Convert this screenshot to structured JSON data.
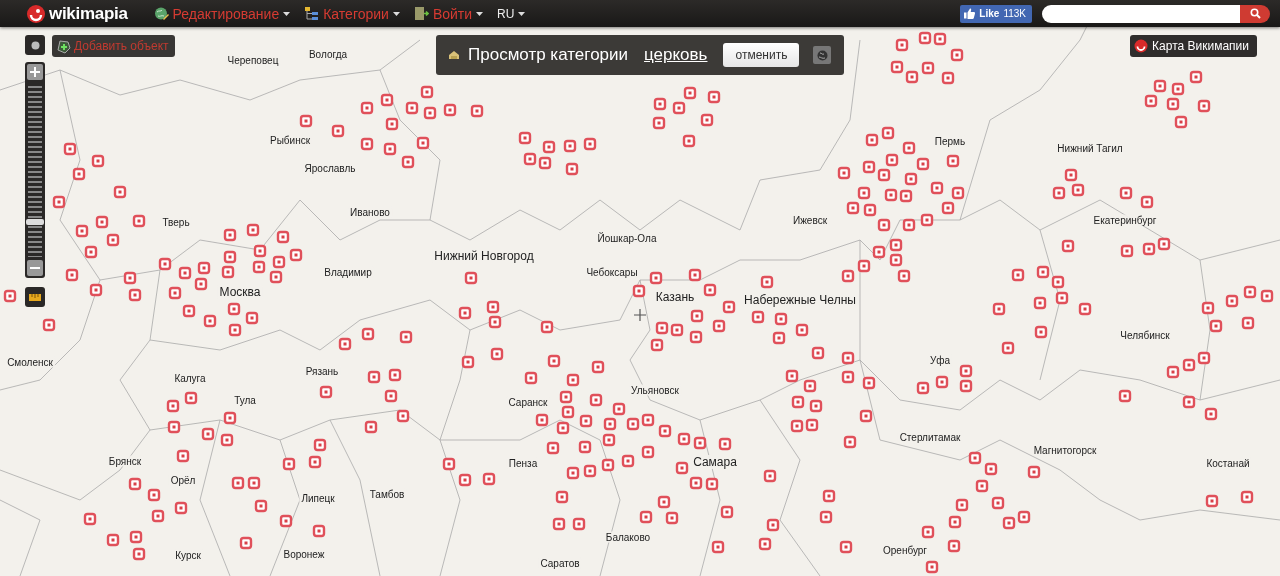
{
  "brand": {
    "name": "wikimapia"
  },
  "menu": [
    {
      "label": "Редактирование",
      "kind": "edit"
    },
    {
      "label": "Категории",
      "kind": "categories"
    },
    {
      "label": "Войти",
      "kind": "login"
    },
    {
      "label": "RU",
      "kind": "lang"
    }
  ],
  "like": {
    "label": "Like",
    "count": "113K"
  },
  "add_object": {
    "label": "Добавить объект"
  },
  "zoom_slider": {
    "level": 0.2
  },
  "category_view": {
    "prefix": "Просмотр категории",
    "category": "церковь",
    "cancel": "отменить"
  },
  "map_type": {
    "label": "Карта Викимапии"
  },
  "cities": [
    {
      "name": "Череповец"
    },
    {
      "name": "Вологда"
    },
    {
      "name": "Рыбинск"
    },
    {
      "name": "Ярославль"
    },
    {
      "name": "Тверь"
    },
    {
      "name": "Иваново"
    },
    {
      "name": "Нижний Новгород"
    },
    {
      "name": "Йошкар-Ола"
    },
    {
      "name": "Чебоксары"
    },
    {
      "name": "Казань"
    },
    {
      "name": "Набережные Челны"
    },
    {
      "name": "Ижевск"
    },
    {
      "name": "Пермь"
    },
    {
      "name": "Нижний Тагил"
    },
    {
      "name": "Екатеринбург"
    },
    {
      "name": "Владимир"
    },
    {
      "name": "Москва"
    },
    {
      "name": "Рязань"
    },
    {
      "name": "Калуга"
    },
    {
      "name": "Тула"
    },
    {
      "name": "Смоленск"
    },
    {
      "name": "Саранск"
    },
    {
      "name": "Ульяновск"
    },
    {
      "name": "Пенза"
    },
    {
      "name": "Самара"
    },
    {
      "name": "Уфа"
    },
    {
      "name": "Стерлитамак"
    },
    {
      "name": "Челябинск"
    },
    {
      "name": "Магнитогорск"
    },
    {
      "name": "Костанай"
    },
    {
      "name": "Липецк"
    },
    {
      "name": "Тамбов"
    },
    {
      "name": "Орёл"
    },
    {
      "name": "Брянск"
    },
    {
      "name": "Курск"
    },
    {
      "name": "Воронеж"
    },
    {
      "name": "Саратов"
    },
    {
      "name": "Балаково"
    },
    {
      "name": "Оренбург"
    }
  ]
}
